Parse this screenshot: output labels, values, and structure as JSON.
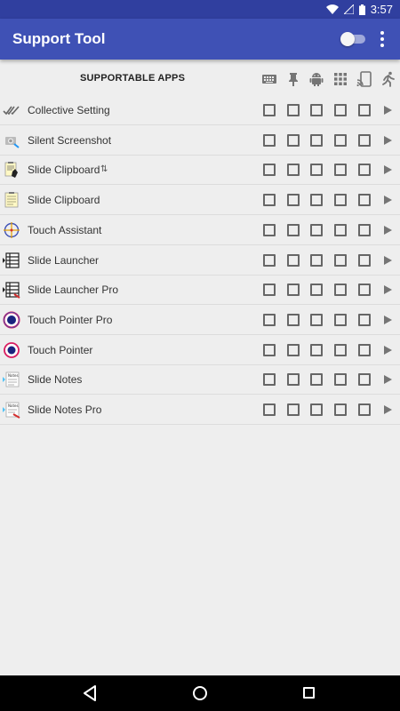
{
  "status_bar": {
    "time": "3:57"
  },
  "app_bar": {
    "title": "Support Tool",
    "toggle_on": false
  },
  "header": {
    "title": "SUPPORTABLE APPS",
    "column_icons": [
      "keyboard-icon",
      "pin-icon",
      "android-icon",
      "grid-icon",
      "cast-screen-icon",
      "running-person-icon"
    ]
  },
  "apps": [
    {
      "name": "Collective Setting",
      "icon": "double-check-icon"
    },
    {
      "name": "Silent Screenshot",
      "icon": "camera-icon"
    },
    {
      "name": "Slide Clipboard",
      "suffix": "⇅",
      "icon": "clipboard-hand-icon"
    },
    {
      "name": "Slide Clipboard",
      "icon": "clipboard-icon"
    },
    {
      "name": "Touch Assistant",
      "icon": "crosshair-icon"
    },
    {
      "name": "Slide Launcher",
      "icon": "launcher-icon"
    },
    {
      "name": "Slide Launcher Pro",
      "icon": "launcher-pro-icon"
    },
    {
      "name": "Touch Pointer Pro",
      "icon": "pointer-pro-icon"
    },
    {
      "name": "Touch Pointer",
      "icon": "pointer-icon"
    },
    {
      "name": "Slide Notes",
      "icon": "notes-icon"
    },
    {
      "name": "Slide Notes Pro",
      "icon": "notes-pro-icon"
    }
  ],
  "colors": {
    "primary": "#3f51b5",
    "primary_dark": "#303f9f",
    "background": "#eeeeee",
    "text": "#333333"
  }
}
